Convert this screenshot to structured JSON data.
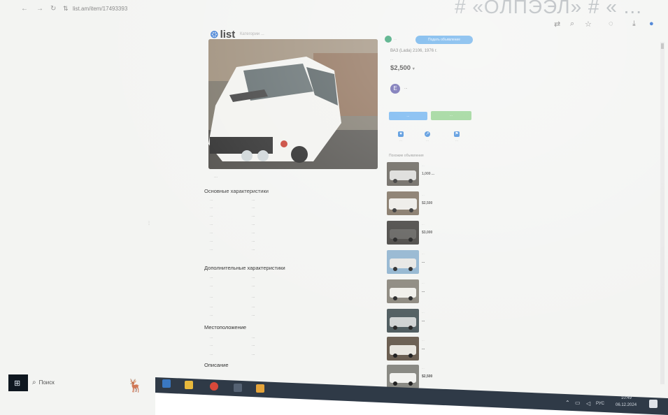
{
  "browser": {
    "url": "list.am/item/17493393",
    "reflection_text": "# «ОЛПЭЭЛ» # « ... ",
    "icons": [
      "back-icon",
      "forward-icon",
      "reload-icon",
      "site-info-icon",
      "translate-icon",
      "zoom-icon",
      "bookmark-star-icon",
      "extensions-icon",
      "download-icon",
      "profile-icon"
    ]
  },
  "page": {
    "logo": "list",
    "top_links": "Категории ...",
    "photo_caption": "...",
    "section_main": "Основные характеристики",
    "main_specs": [
      {
        "k": "...",
        "v": "..."
      },
      {
        "k": "...",
        "v": "..."
      },
      {
        "k": "...",
        "v": "..."
      },
      {
        "k": "...",
        "v": "..."
      },
      {
        "k": "...",
        "v": "..."
      },
      {
        "k": "...",
        "v": "..."
      },
      {
        "k": "...",
        "v": "..."
      }
    ],
    "section_extra": "Дополнительные характеристики",
    "extra_specs": [
      {
        "k": "...",
        "v": "..."
      },
      {
        "k": "...",
        "v": "..."
      },
      {
        "k": "...",
        "v": "..."
      },
      {
        "k": "...",
        "v": "..."
      },
      {
        "k": "...",
        "v": "..."
      }
    ],
    "section_location": "Местоположение",
    "location_rows": [
      {
        "k": "...",
        "v": "..."
      },
      {
        "k": "...",
        "v": "..."
      },
      {
        "k": "...",
        "v": "..."
      }
    ],
    "section_desc": "Описание",
    "seller_badge_label": "...",
    "post_button": "Подать объявление",
    "ad_title": "ВАЗ (Lada) 2106, 1976 г.",
    "ad_subtitle": "...",
    "price": "$2,500",
    "price_suffix": "▾",
    "seller_initial": "E",
    "seller_name": "...",
    "call_button": "...",
    "message_button": "...",
    "actions": [
      "...",
      "...",
      "..."
    ],
    "similar_title": "Похожие объявления",
    "similar": [
      {
        "title": "...",
        "price": "1,000 ..."
      },
      {
        "title": "...",
        "price": "$2,500"
      },
      {
        "title": "...",
        "price": "$3,000"
      },
      {
        "title": "...",
        "price": "..."
      },
      {
        "title": "...",
        "price": "..."
      },
      {
        "title": "...",
        "price": "..."
      },
      {
        "title": "...",
        "price": "..."
      },
      {
        "title": "...",
        "price": "$2,500"
      }
    ]
  },
  "taskbar": {
    "search_label": "Поиск",
    "tray_lang": "РУС",
    "time": "10:49",
    "date": "06.12.2024",
    "tray_small": "..."
  },
  "colors": {
    "accent": "#3a7bd5",
    "green": "#8fd08a",
    "blue_button": "#6ab0ef",
    "taskbar": "#2f3a47"
  }
}
